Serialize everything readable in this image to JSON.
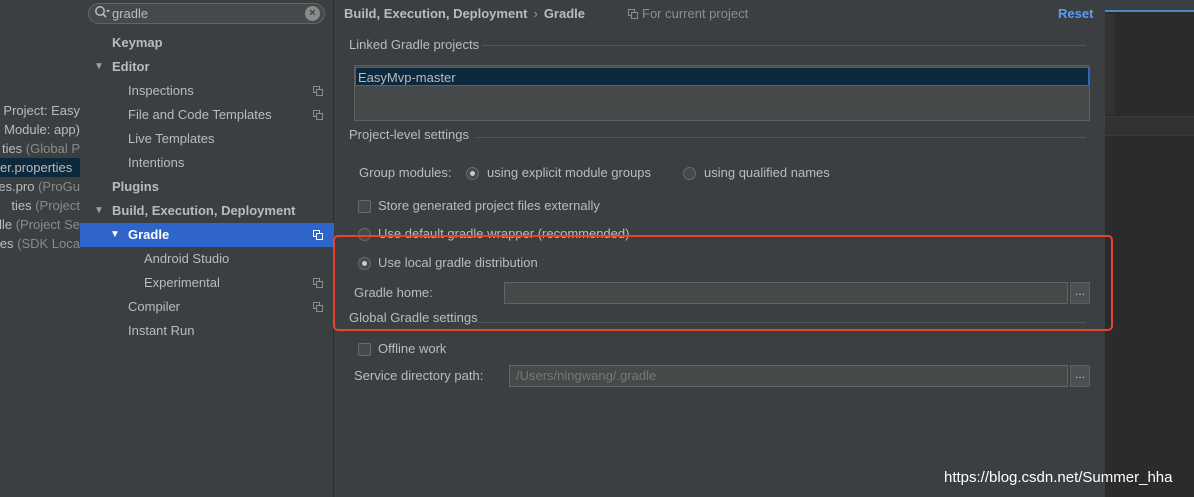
{
  "background_tree": [
    {
      "main": "Project: Easy",
      "muted": ""
    },
    {
      "main": "Module: app)",
      "muted": ""
    },
    {
      "main": "ties",
      "muted": " (Global P"
    },
    {
      "main": "er.properties",
      "muted": ""
    },
    {
      "main": "es.pro",
      "muted": " (ProGu"
    },
    {
      "main": "ties",
      "muted": " (Project"
    },
    {
      "main": "dle",
      "muted": " (Project Se"
    },
    {
      "main": "es",
      "muted": " (SDK Loca"
    }
  ],
  "search": {
    "value": "gradle"
  },
  "sidebar": {
    "keymap": "Keymap",
    "editor": "Editor",
    "inspections": "Inspections",
    "file_templates": "File and Code Templates",
    "live_templates": "Live Templates",
    "intentions": "Intentions",
    "plugins": "Plugins",
    "build": "Build, Execution, Deployment",
    "gradle": "Gradle",
    "android_studio": "Android Studio",
    "experimental": "Experimental",
    "compiler": "Compiler",
    "instant_run": "Instant Run"
  },
  "header": {
    "crumb_parent": "Build, Execution, Deployment",
    "crumb_sep": "›",
    "crumb_current": "Gradle",
    "for_project": "For current project",
    "reset": "Reset"
  },
  "linked": {
    "title": "Linked Gradle projects",
    "items": [
      "EasyMvp-master"
    ]
  },
  "project_level": {
    "title": "Project-level settings",
    "group_modules_label": "Group modules:",
    "opt_explicit": "using explicit module groups",
    "opt_qualified": "using qualified names",
    "store_externally": "Store generated project files externally",
    "use_default_wrapper": "Use default gradle wrapper (recommended)",
    "use_local": "Use local gradle distribution",
    "gradle_home_label": "Gradle home:",
    "gradle_home_value": ""
  },
  "global": {
    "title": "Global Gradle settings",
    "offline": "Offline work",
    "service_dir_label": "Service directory path:",
    "service_dir_value": "/Users/ningwang/.gradle"
  },
  "browse_label": "...",
  "watermark": "https://blog.csdn.net/Summer_hha",
  "colors": {
    "accent": "#2f65ca",
    "link": "#589df6",
    "highlight": "#e8432c"
  }
}
